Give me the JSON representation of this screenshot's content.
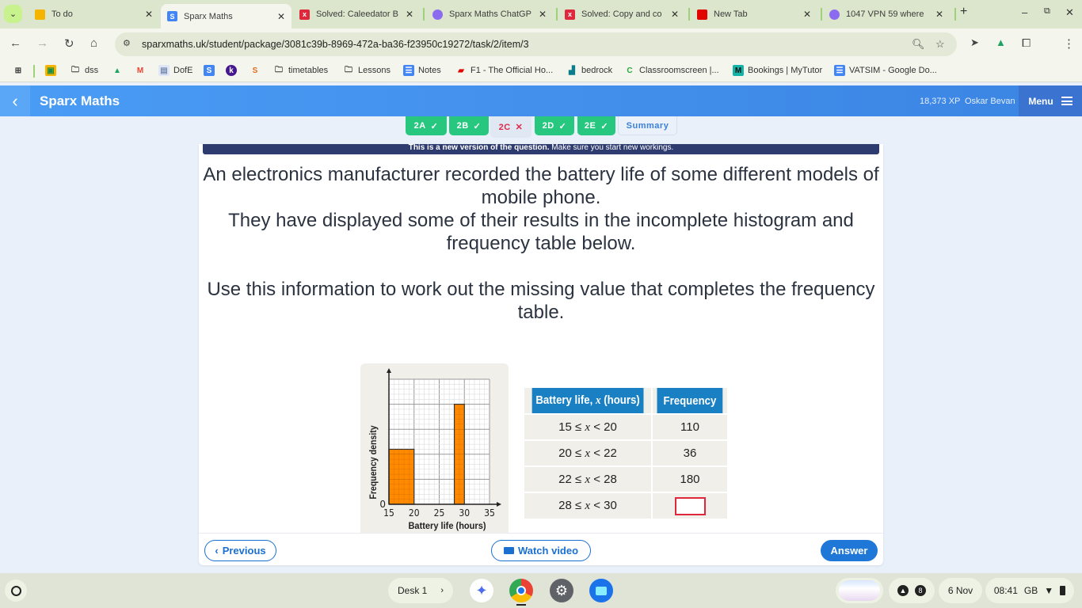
{
  "browser": {
    "tabs": [
      {
        "title": "To do",
        "favicon": "google-classroom-icon",
        "color": "#f4b400"
      },
      {
        "title": "Sparx Maths",
        "favicon": "sparx-s-icon",
        "color": "#4285f4",
        "active": true
      },
      {
        "title": "Solved: Caleedator B",
        "favicon": "chegg-x-icon",
        "color": "#e0283c"
      },
      {
        "title": "Sparx Maths ChatGP",
        "favicon": "gem-icon",
        "color": "#8b6cf0"
      },
      {
        "title": "Solved: Copy and co",
        "favicon": "chegg-x-icon",
        "color": "#e0283c"
      },
      {
        "title": "New Tab",
        "favicon": "f1-icon",
        "color": "#e10600"
      },
      {
        "title": "1047 VPN 59 where",
        "favicon": "gem-icon",
        "color": "#8b6cf0"
      }
    ],
    "new_tab": "+",
    "url": "sparxmaths.uk/student/package/3081c39b-8969-472a-ba36-f23950c19272/task/2/item/3",
    "bookmarks": [
      {
        "label": "",
        "icon": "apps-grid-icon"
      },
      {
        "label": "",
        "icon": "google-classroom-icon"
      },
      {
        "label": "dss",
        "icon": "folder-icon"
      },
      {
        "label": "",
        "icon": "google-drive-icon"
      },
      {
        "label": "",
        "icon": "gmail-icon"
      },
      {
        "label": "DofE",
        "icon": "doc-icon"
      },
      {
        "label": "",
        "icon": "sparx-s-icon"
      },
      {
        "label": "",
        "icon": "kahoot-k-icon"
      },
      {
        "label": "",
        "icon": "sparx-colour-icon"
      },
      {
        "label": "timetables",
        "icon": "folder-icon"
      },
      {
        "label": "Lessons",
        "icon": "folder-icon"
      },
      {
        "label": "Notes",
        "icon": "google-docs-icon"
      },
      {
        "label": "F1 - The Official Ho...",
        "icon": "f1-icon"
      },
      {
        "label": "bedrock",
        "icon": "bedrock-icon"
      },
      {
        "label": "Classroomscreen |...",
        "icon": "classroomscreen-icon"
      },
      {
        "label": "Bookings | MyTutor",
        "icon": "mytutor-m-icon"
      },
      {
        "label": "VATSIM - Google Do...",
        "icon": "google-docs-icon"
      }
    ]
  },
  "app": {
    "title": "Sparx Maths",
    "xp": "18,373 XP",
    "user": "Oskar Bevan",
    "menu_label": "Menu",
    "task_tabs": [
      {
        "label": "2A",
        "status": "correct",
        "mark": "✓"
      },
      {
        "label": "2B",
        "status": "correct",
        "mark": "✓"
      },
      {
        "label": "2C",
        "status": "incorrect",
        "mark": "✕"
      },
      {
        "label": "2D",
        "status": "correct",
        "mark": "✓"
      },
      {
        "label": "2E",
        "status": "correct",
        "mark": "✓"
      },
      {
        "label": "Summary",
        "status": "summary",
        "mark": ""
      }
    ],
    "notice_bold": "This is a new version of the question.",
    "notice_rest": " Make sure you start new workings.",
    "question": [
      "An electronics manufacturer recorded the battery life of some different models of mobile phone.",
      "They have displayed some of their results in the incomplete histogram and frequency table below.",
      "Use this information to work out the missing value that completes the frequency table."
    ],
    "table": {
      "headers": [
        "Battery life, x (hours)",
        "Frequency"
      ],
      "rows": [
        {
          "interval": "15 ≤ x < 20",
          "lo": "15",
          "hi": "20",
          "frequency": "110"
        },
        {
          "interval": "20 ≤ x < 22",
          "lo": "20",
          "hi": "22",
          "frequency": "36"
        },
        {
          "interval": "22 ≤ x < 28",
          "lo": "22",
          "hi": "28",
          "frequency": "180"
        },
        {
          "interval": "28 ≤ x < 30",
          "lo": "28",
          "hi": "30",
          "frequency": ""
        }
      ],
      "answer_value": ""
    },
    "buttons": {
      "previous": "Previous",
      "watch_video": "Watch video",
      "answer": "Answer"
    }
  },
  "chart_data": {
    "type": "bar",
    "subtype": "histogram",
    "xlabel": "Battery life (hours)",
    "ylabel": "Frequency density",
    "x_ticks": [
      "15",
      "20",
      "25",
      "30",
      "35"
    ],
    "y_ticks": [
      "0"
    ],
    "xlim": [
      15,
      35
    ],
    "ylim": [
      0,
      50
    ],
    "grid": true,
    "bars": [
      {
        "from": 15,
        "to": 20,
        "density": 22
      },
      {
        "from": 28,
        "to": 30,
        "density": 40
      }
    ],
    "bar_color": "#ff8a00"
  },
  "os": {
    "desk": "Desk 1",
    "notification_count": "8",
    "date": "6 Nov",
    "time": "08:41",
    "locale": "GB"
  }
}
